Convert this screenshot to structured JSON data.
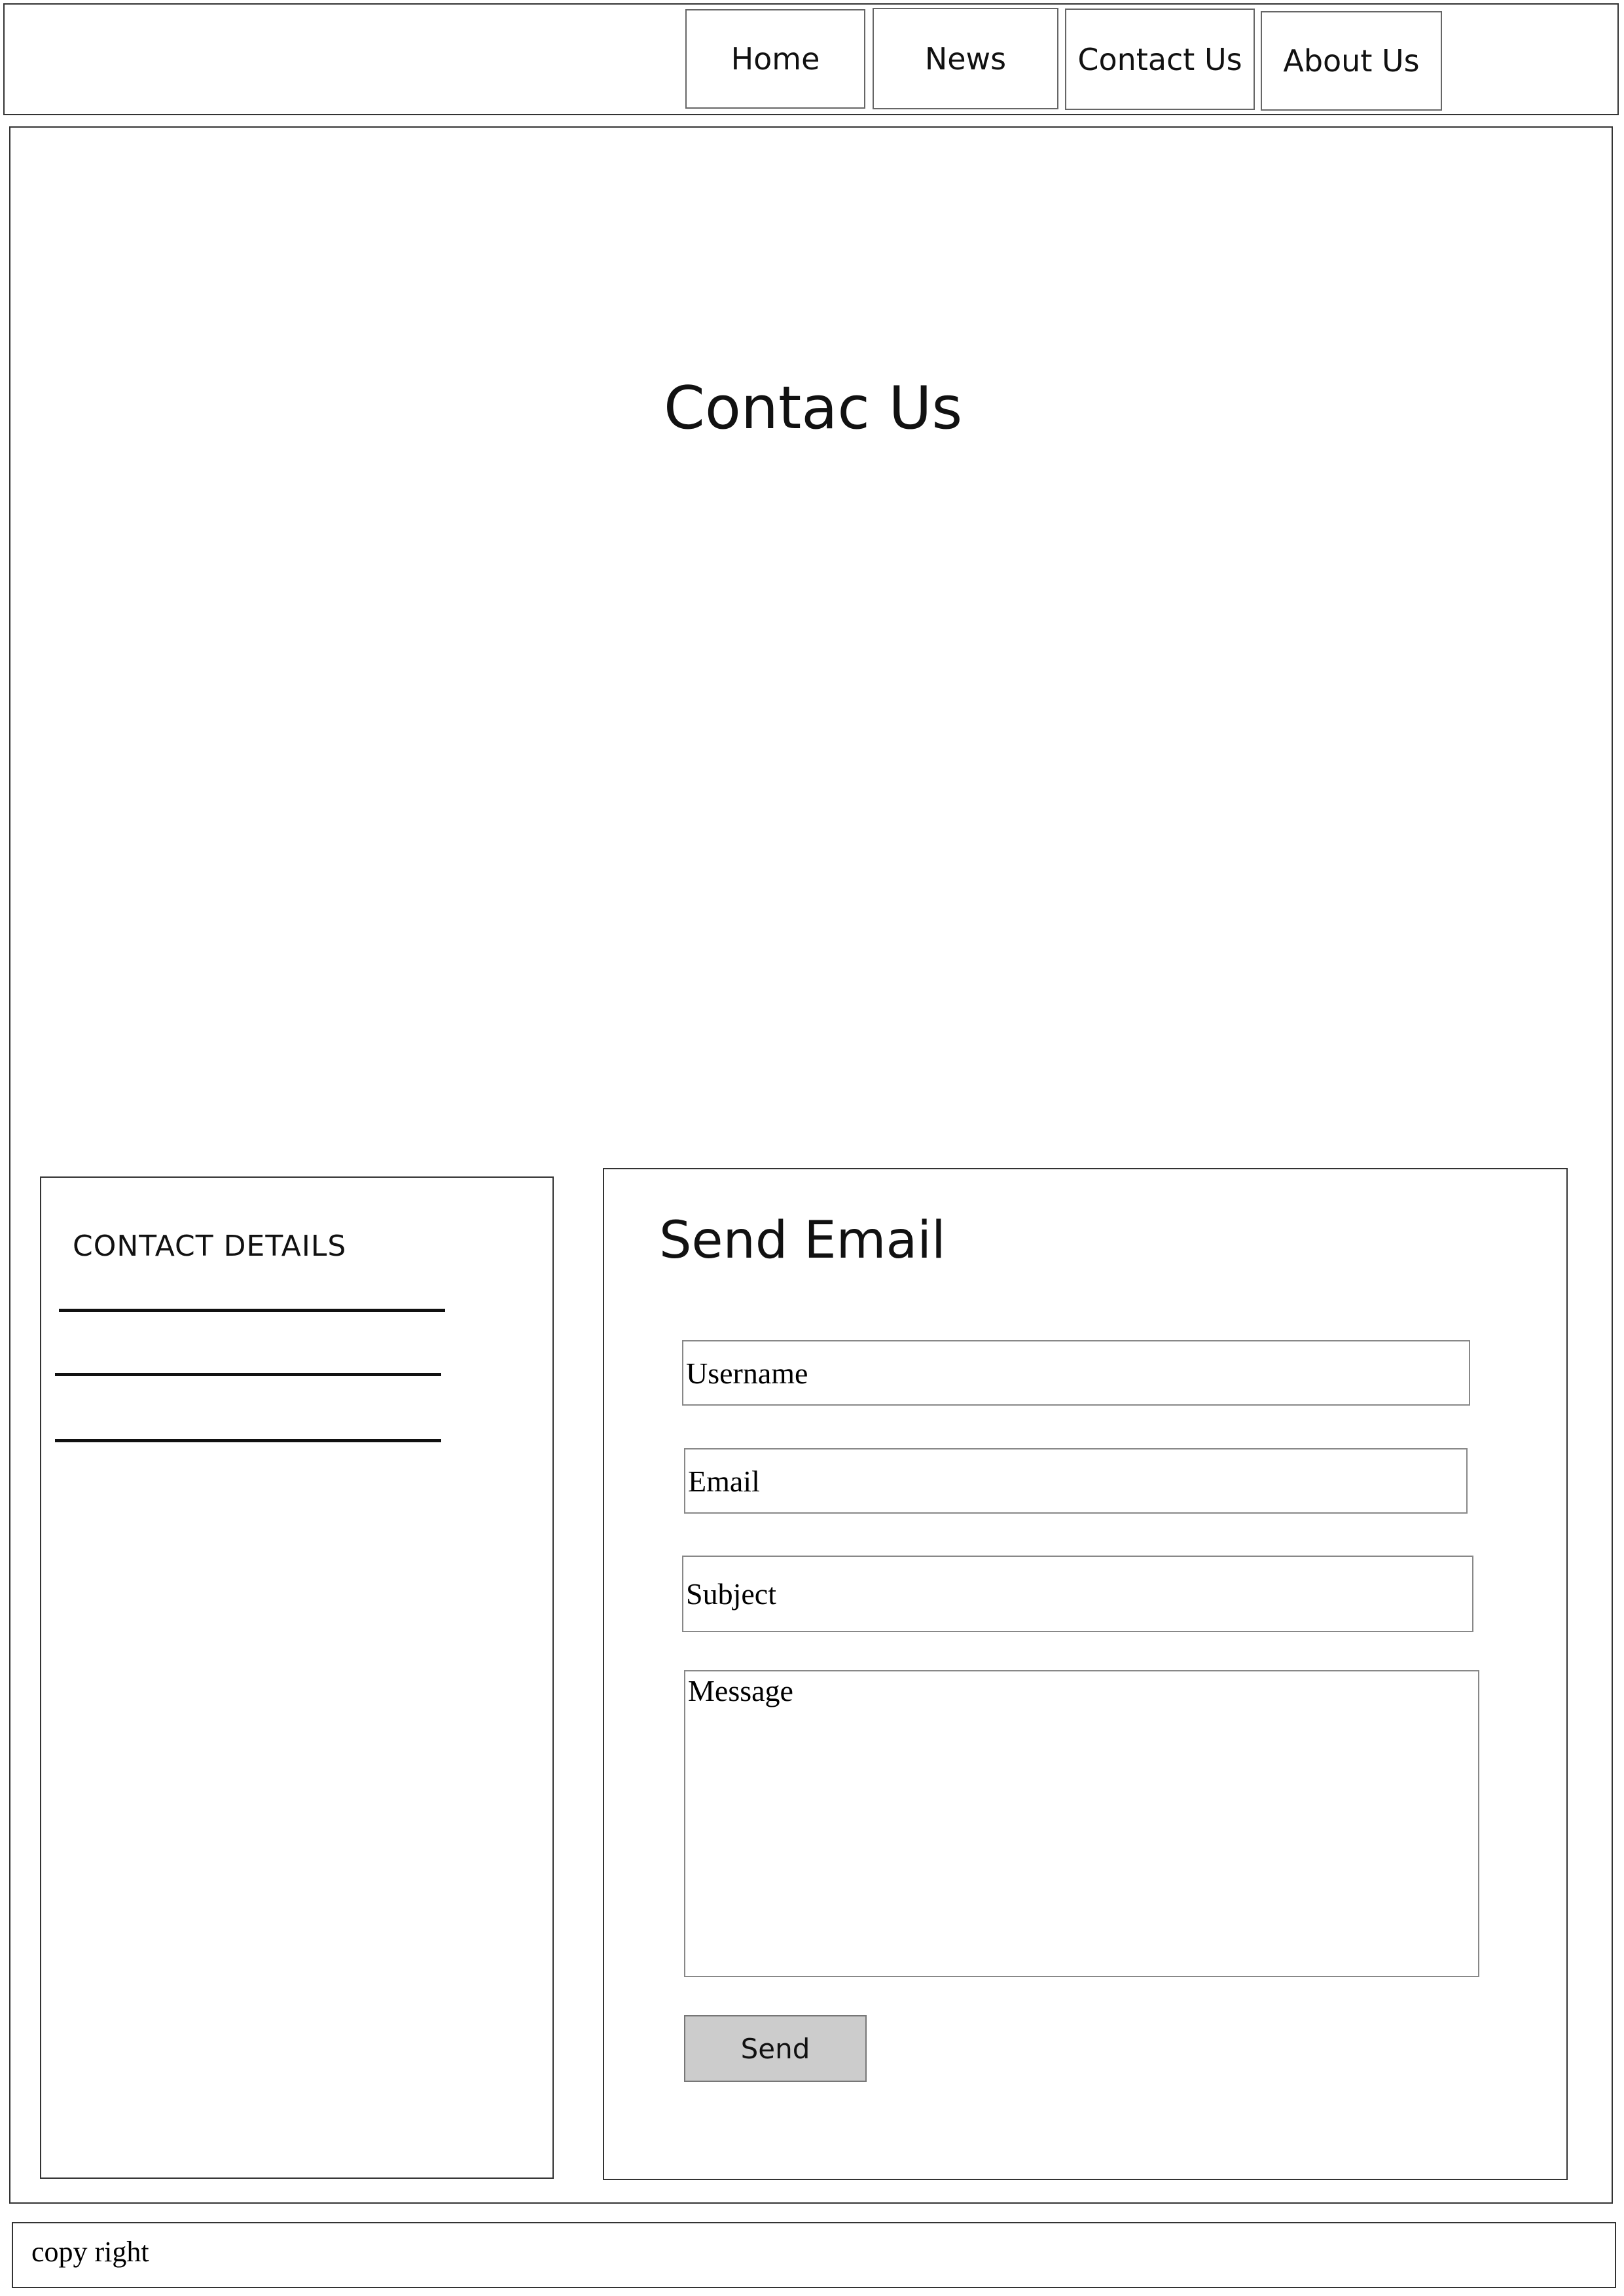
{
  "nav": {
    "items": [
      {
        "label": "Home"
      },
      {
        "label": "News"
      },
      {
        "label": "Contact Us"
      },
      {
        "label": "About Us"
      }
    ]
  },
  "hero": {
    "title": "Contac Us"
  },
  "contact_details": {
    "title": "CONTACT DETAILS"
  },
  "email_form": {
    "title": "Send Email",
    "username_placeholder": "Username",
    "email_placeholder": "Email",
    "subject_placeholder": "Subject",
    "message_placeholder": "Message",
    "send_label": "Send",
    "send_button_color": "#cccccc"
  },
  "footer": {
    "text": "copy right"
  }
}
